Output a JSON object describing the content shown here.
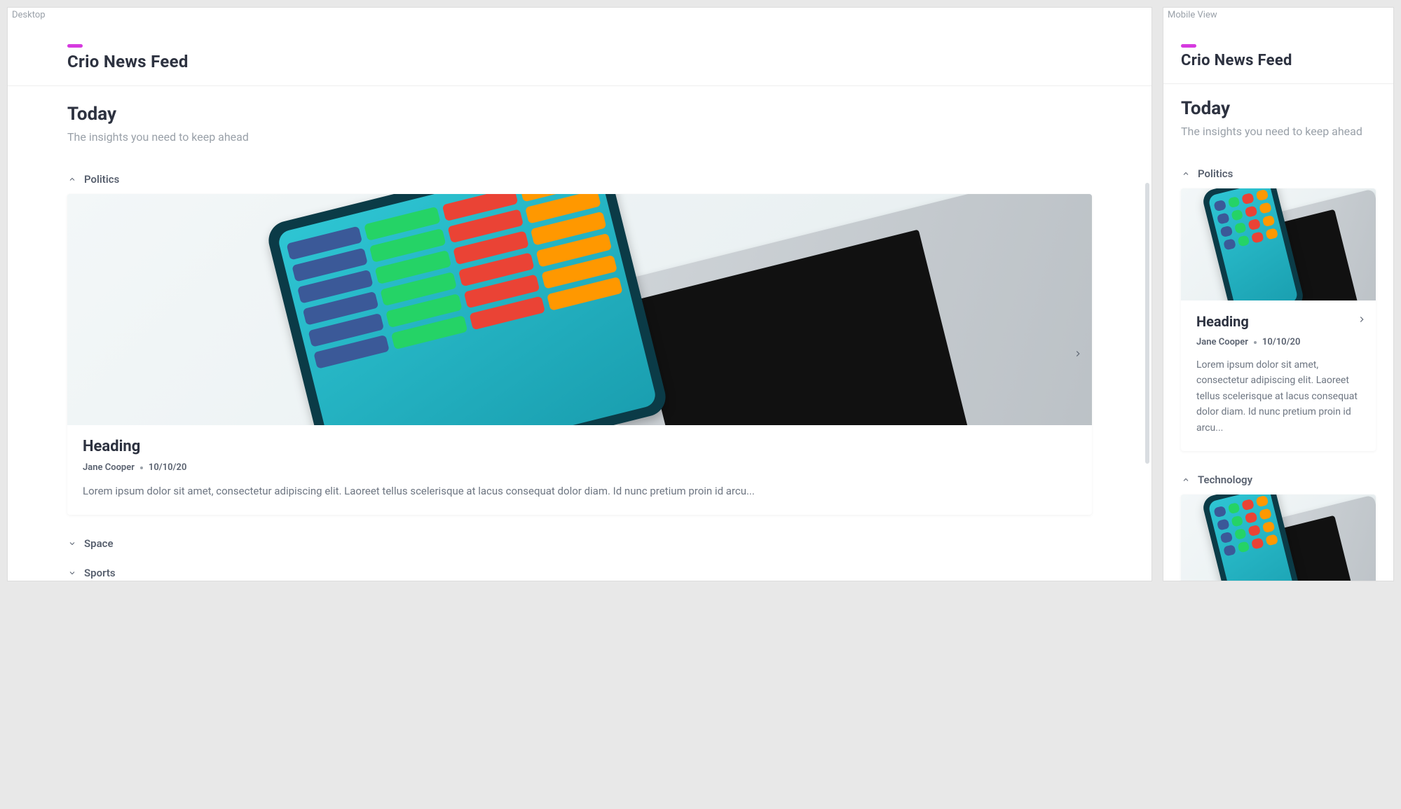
{
  "labels": {
    "desktop_preview": "Desktop",
    "mobile_preview": "Mobile View"
  },
  "brand": "Crio News Feed",
  "section": {
    "title": "Today",
    "subtitle": "The insights you need to keep ahead"
  },
  "categories": [
    {
      "name": "Politics",
      "expanded": true
    },
    {
      "name": "Space",
      "expanded": false
    },
    {
      "name": "Sports",
      "expanded": false
    },
    {
      "name": "Technology",
      "expanded": true
    }
  ],
  "article": {
    "heading": "Heading",
    "author": "Jane Cooper",
    "date": "10/10/20",
    "excerpt": "Lorem ipsum dolor sit amet, consectetur adipiscing elit. Laoreet tellus scelerisque at lacus consequat dolor diam. Id nunc pretium proin id arcu..."
  }
}
